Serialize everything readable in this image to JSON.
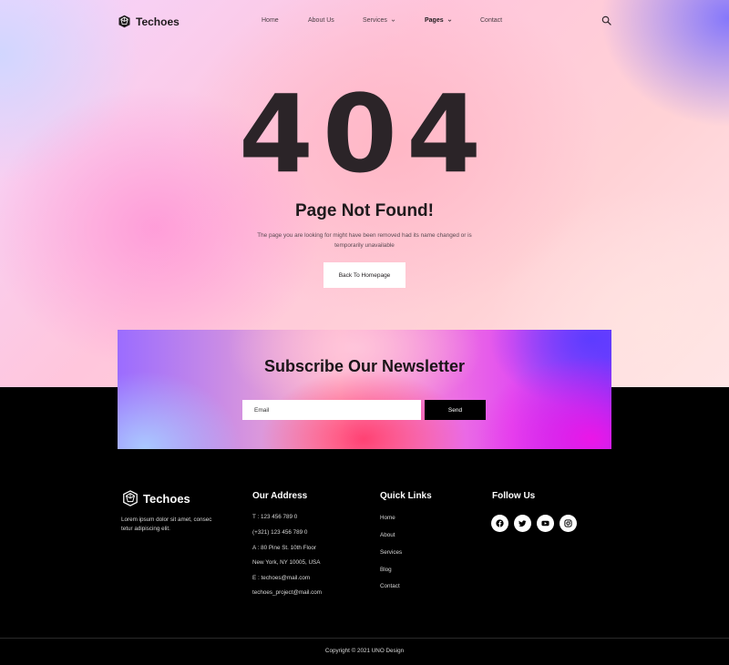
{
  "header": {
    "brand": "Techoes",
    "nav": [
      {
        "label": "Home"
      },
      {
        "label": "About Us"
      },
      {
        "label": "Services"
      },
      {
        "label": "Pages"
      },
      {
        "label": "Contact"
      }
    ],
    "active_item": "Pages",
    "search_icon": "search-icon"
  },
  "error": {
    "code": "404",
    "title": "Page Not Found!",
    "description": "The page you are looking for might have been removed had its name changed or is temporarily unavailable",
    "button_label": "Back To Homepage"
  },
  "newsletter": {
    "title": "Subscribe Our Newsletter",
    "email_placeholder": "Email",
    "send_label": "Send"
  },
  "footer": {
    "brand": "Techoes",
    "about": "Lorem ipsum dolor sit amet, consec tetur adipiscing elit.",
    "address": {
      "heading": "Our Address",
      "lines": [
        "T : 123 456 789 0",
        "(+321) 123 456 789 0",
        "A : 80 Pine St. 10th Floor",
        "New York, NY 10005, USA",
        "E : techoes@mail.com",
        "techoes_project@mail.com"
      ]
    },
    "quick_links": {
      "heading": "Quick Links",
      "items": [
        "Home",
        "About",
        "Services",
        "Blog",
        "Contact"
      ]
    },
    "follow": {
      "heading": "Follow Us",
      "icons": [
        "facebook-icon",
        "twitter-icon",
        "youtube-icon",
        "instagram-icon"
      ]
    },
    "copyright": "Copyright © 2021 UNO Design"
  },
  "colors": {
    "dark_text": "#2b2428",
    "footer_bg": "#000000",
    "button_bg": "#ffffff",
    "send_bg": "#000000"
  }
}
